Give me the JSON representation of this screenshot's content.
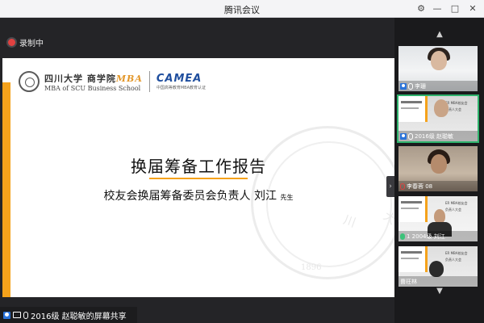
{
  "window": {
    "title": "腾讯会议"
  },
  "recording": {
    "label": "录制中"
  },
  "slide": {
    "school_cn": "四川大学 商学院",
    "school_mba": "MBA",
    "school_en": "MBA of SCU Business School",
    "camea_name": "CAMEA",
    "camea_sub": "中国高等教育MBA教育认证",
    "title": "换届筹备工作报告",
    "subtitle": "校友会换届筹备委员会负责人 刘江",
    "subtitle_suffix": "先生",
    "watermark_year": "1896"
  },
  "participants": [
    {
      "name": "李珊",
      "mic": "on"
    },
    {
      "name": "2016级 赵聪敏",
      "mic": "on",
      "active": true,
      "mini_a": "ER MBA校友会",
      "mini_b": "负责人大会"
    },
    {
      "name": "李春蓉 08",
      "mic": "muted"
    },
    {
      "name": "1 2004级 刘江",
      "mic": "speaking",
      "mini_a": "ER MBA校友会",
      "mini_b": "负责人大会"
    },
    {
      "name": "曹旺林",
      "mic": "on",
      "mini_a": "ER MBA校友会",
      "mini_b": "负责人大会"
    }
  ],
  "share": {
    "label": "2016级 赵聪敏的屏幕共享"
  }
}
